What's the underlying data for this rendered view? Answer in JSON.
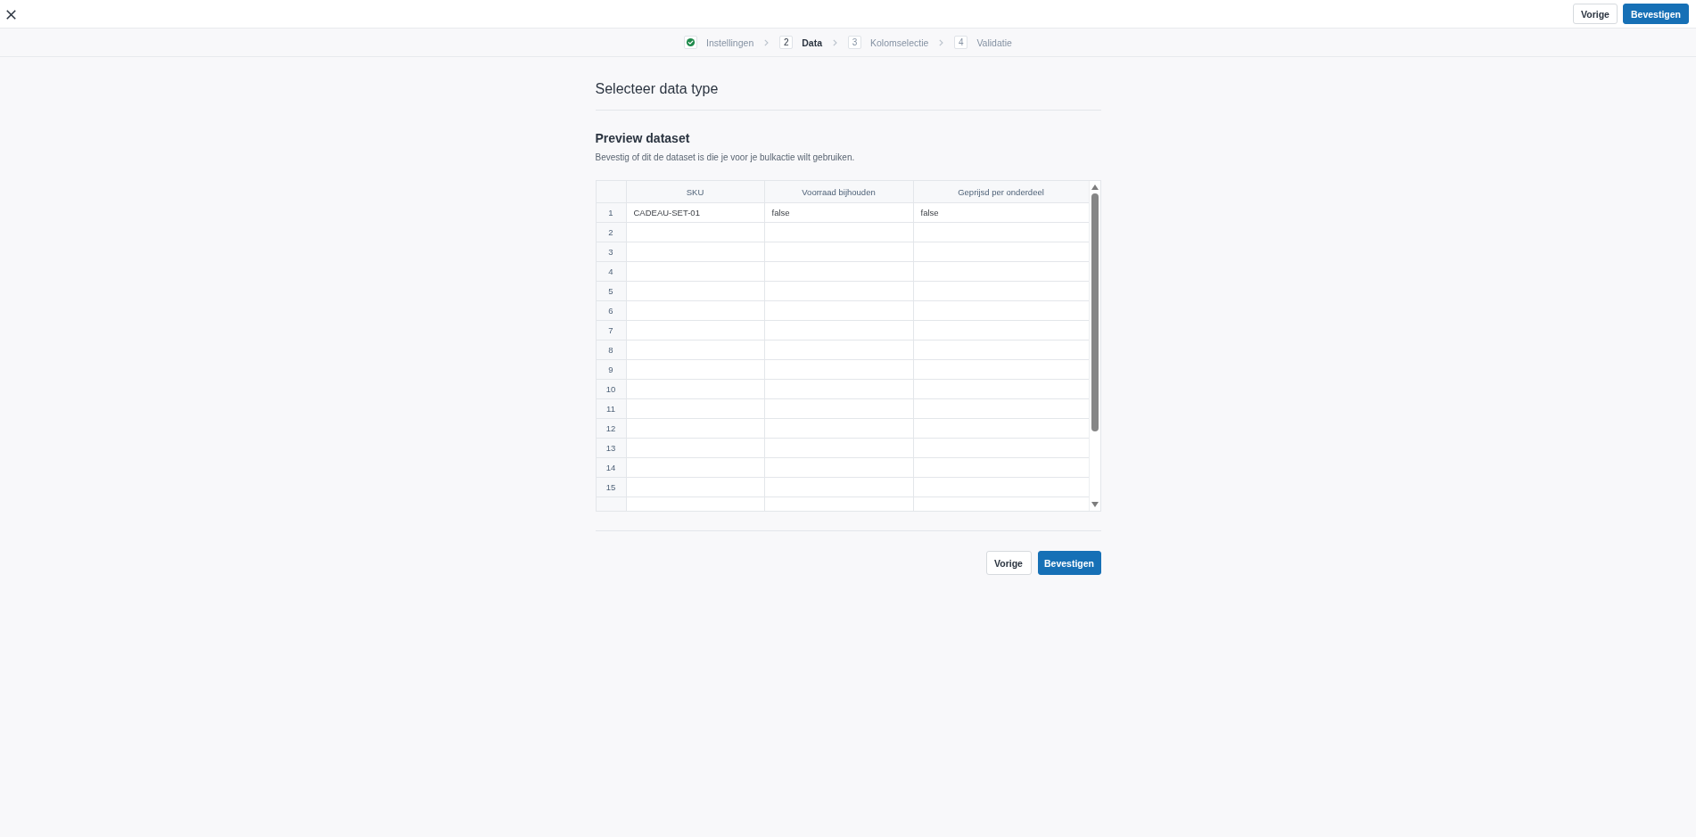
{
  "top_bar": {
    "buttons": [
      {
        "label": "Vorige",
        "kind": "secondary"
      },
      {
        "label": "Bevestigen",
        "kind": "primary"
      }
    ]
  },
  "stepper": {
    "steps": [
      {
        "label": "Instellingen",
        "completed": true,
        "selected": false
      },
      {
        "number": "2",
        "label": "Data",
        "completed": false,
        "selected": true
      },
      {
        "number": "3",
        "label": "Kolomselectie",
        "completed": false,
        "selected": false
      },
      {
        "number": "4",
        "label": "Validatie",
        "completed": false,
        "selected": false
      }
    ]
  },
  "section": {
    "title": "Selecteer data type"
  },
  "preview": {
    "title": "Preview dataset",
    "description": "Bevestig of dit de dataset is die je voor je bulkactie wilt gebruiken.",
    "table": {
      "columns": [
        "SKU",
        "Voorraad bijhouden",
        "Geprijsd per onderdeel"
      ],
      "rows": [
        {
          "number": "1",
          "cells": [
            "CADEAU-SET-01",
            "false",
            "false"
          ]
        },
        {
          "number": "2"
        },
        {
          "number": "3"
        },
        {
          "number": "4"
        },
        {
          "number": "5"
        },
        {
          "number": "6"
        },
        {
          "number": "7"
        },
        {
          "number": "8"
        },
        {
          "number": "9"
        },
        {
          "number": "10"
        },
        {
          "number": "11"
        },
        {
          "number": "12"
        },
        {
          "number": "13"
        },
        {
          "number": "14"
        },
        {
          "number": "15"
        }
      ]
    }
  },
  "footer": {
    "buttons": [
      {
        "label": "Vorige",
        "kind": "secondary"
      },
      {
        "label": "Bevestigen",
        "kind": "primary"
      }
    ]
  }
}
